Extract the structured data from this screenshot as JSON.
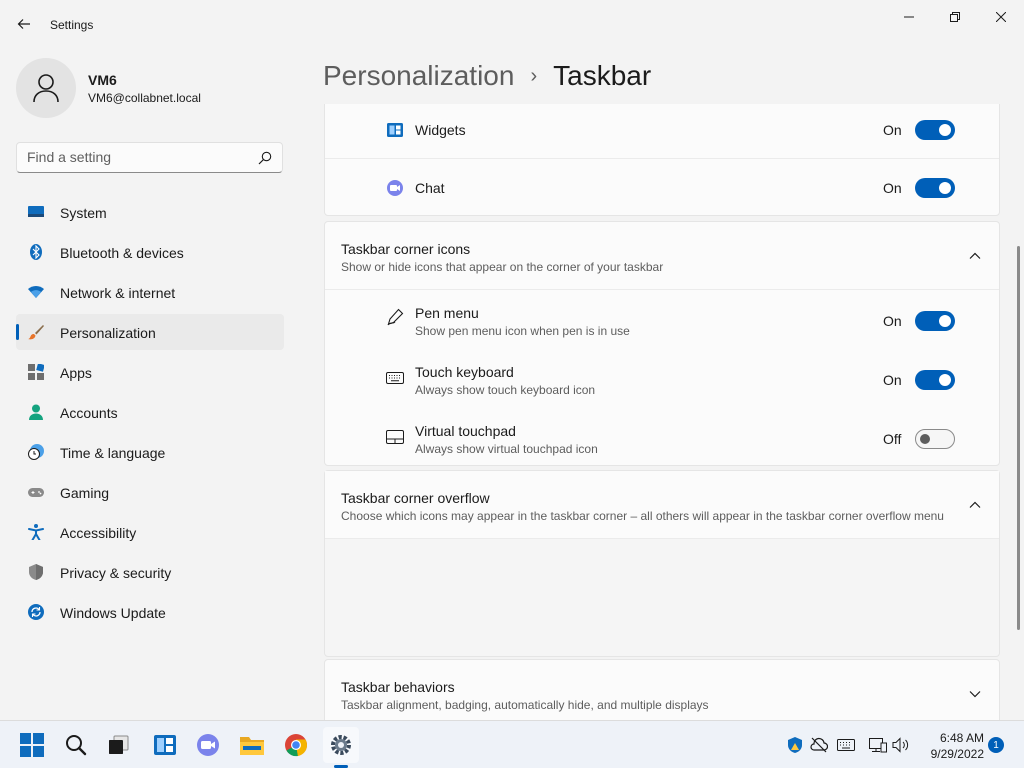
{
  "window": {
    "title": "Settings"
  },
  "user": {
    "name": "VM6",
    "email": "VM6@collabnet.local"
  },
  "search": {
    "placeholder": "Find a setting"
  },
  "nav": {
    "items": [
      {
        "label": "System",
        "icon": "system-icon"
      },
      {
        "label": "Bluetooth & devices",
        "icon": "bluetooth-icon"
      },
      {
        "label": "Network & internet",
        "icon": "wifi-icon"
      },
      {
        "label": "Personalization",
        "icon": "brush-icon",
        "active": true
      },
      {
        "label": "Apps",
        "icon": "apps-icon"
      },
      {
        "label": "Accounts",
        "icon": "accounts-icon"
      },
      {
        "label": "Time & language",
        "icon": "clock-globe-icon"
      },
      {
        "label": "Gaming",
        "icon": "gamepad-icon"
      },
      {
        "label": "Accessibility",
        "icon": "accessibility-icon"
      },
      {
        "label": "Privacy & security",
        "icon": "shield-icon"
      },
      {
        "label": "Windows Update",
        "icon": "update-icon"
      }
    ]
  },
  "breadcrumb": {
    "parent": "Personalization",
    "separator": "›",
    "current": "Taskbar"
  },
  "taskbar_items": {
    "widgets": {
      "label": "Widgets",
      "state": "On",
      "on": true
    },
    "chat": {
      "label": "Chat",
      "state": "On",
      "on": true
    }
  },
  "corner_icons": {
    "title": "Taskbar corner icons",
    "subtitle": "Show or hide icons that appear on the corner of your taskbar",
    "expanded": true,
    "items": [
      {
        "label": "Pen menu",
        "sub": "Show pen menu icon when pen is in use",
        "state": "On",
        "on": true,
        "icon": "pen-icon"
      },
      {
        "label": "Touch keyboard",
        "sub": "Always show touch keyboard icon",
        "state": "On",
        "on": true,
        "icon": "keyboard-icon"
      },
      {
        "label": "Virtual touchpad",
        "sub": "Always show virtual touchpad icon",
        "state": "Off",
        "on": false,
        "icon": "touchpad-icon"
      }
    ]
  },
  "corner_overflow": {
    "title": "Taskbar corner overflow",
    "subtitle": "Choose which icons may appear in the taskbar corner – all others will appear in the taskbar corner overflow menu",
    "expanded": true
  },
  "behaviors": {
    "title": "Taskbar behaviors",
    "subtitle": "Taskbar alignment, badging, automatically hide, and multiple displays",
    "expanded": false
  },
  "system_taskbar": {
    "time": "6:48 AM",
    "date": "9/29/2022",
    "notification_count": "1"
  },
  "colors": {
    "accent": "#005fb8",
    "background": "#f3f3f3",
    "card": "#fbfbfb"
  }
}
